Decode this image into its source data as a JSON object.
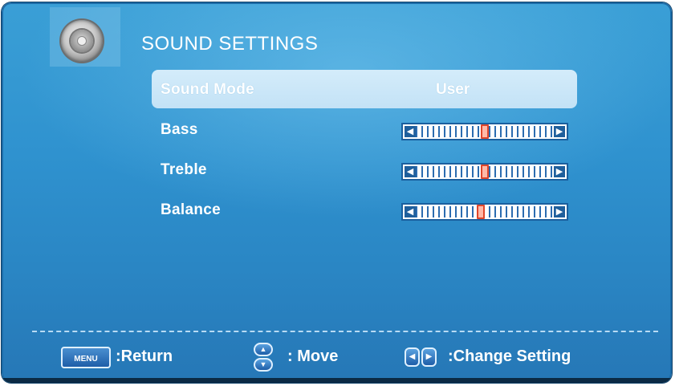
{
  "menu": {
    "title": "SOUND SETTINGS",
    "items": [
      {
        "label": "Sound Mode",
        "value": "User",
        "selected": true
      },
      {
        "label": "Bass",
        "level": 0.5
      },
      {
        "label": "Treble",
        "level": 0.5
      },
      {
        "label": "Balance",
        "level": 0.47
      }
    ]
  },
  "footer": {
    "menu_key": "MENU",
    "return_label": ":Return",
    "move_label": ": Move",
    "change_label": ":Change Setting"
  },
  "colors": {
    "background": "#2f92cf",
    "selected_row": "#c3e2f6",
    "thumb_fill": "#ffb9a8",
    "thumb_border": "#e0462a"
  },
  "icons": {
    "header": "speaker-icon",
    "slider_left": "arrow-left-icon",
    "slider_right": "arrow-right-icon",
    "move": "up-down-icon",
    "change": "left-right-icon"
  }
}
